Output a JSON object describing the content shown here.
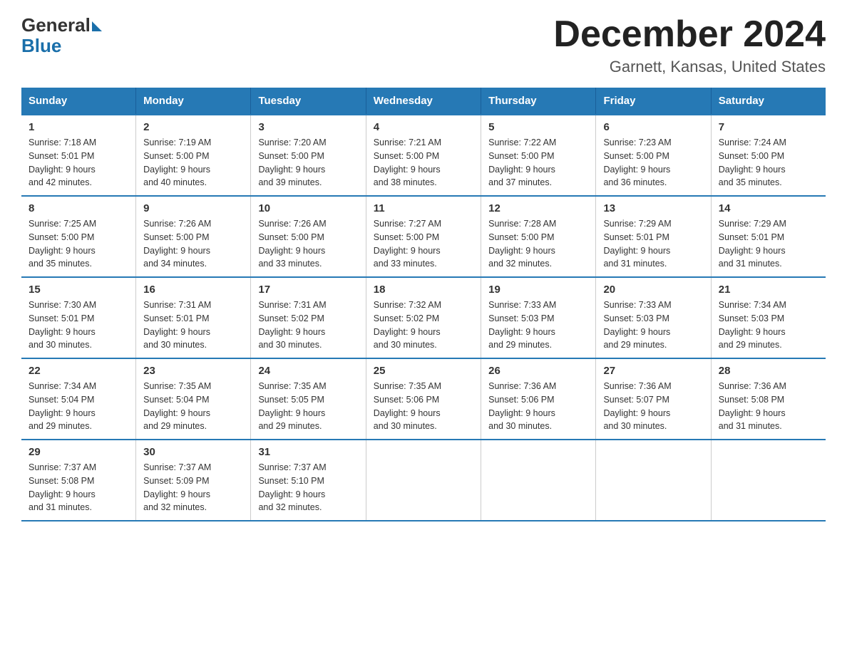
{
  "logo": {
    "general": "General",
    "blue": "Blue"
  },
  "title": "December 2024",
  "subtitle": "Garnett, Kansas, United States",
  "days_of_week": [
    "Sunday",
    "Monday",
    "Tuesday",
    "Wednesday",
    "Thursday",
    "Friday",
    "Saturday"
  ],
  "weeks": [
    [
      {
        "day": "1",
        "sunrise": "7:18 AM",
        "sunset": "5:01 PM",
        "daylight": "9 hours and 42 minutes."
      },
      {
        "day": "2",
        "sunrise": "7:19 AM",
        "sunset": "5:00 PM",
        "daylight": "9 hours and 40 minutes."
      },
      {
        "day": "3",
        "sunrise": "7:20 AM",
        "sunset": "5:00 PM",
        "daylight": "9 hours and 39 minutes."
      },
      {
        "day": "4",
        "sunrise": "7:21 AM",
        "sunset": "5:00 PM",
        "daylight": "9 hours and 38 minutes."
      },
      {
        "day": "5",
        "sunrise": "7:22 AM",
        "sunset": "5:00 PM",
        "daylight": "9 hours and 37 minutes."
      },
      {
        "day": "6",
        "sunrise": "7:23 AM",
        "sunset": "5:00 PM",
        "daylight": "9 hours and 36 minutes."
      },
      {
        "day": "7",
        "sunrise": "7:24 AM",
        "sunset": "5:00 PM",
        "daylight": "9 hours and 35 minutes."
      }
    ],
    [
      {
        "day": "8",
        "sunrise": "7:25 AM",
        "sunset": "5:00 PM",
        "daylight": "9 hours and 35 minutes."
      },
      {
        "day": "9",
        "sunrise": "7:26 AM",
        "sunset": "5:00 PM",
        "daylight": "9 hours and 34 minutes."
      },
      {
        "day": "10",
        "sunrise": "7:26 AM",
        "sunset": "5:00 PM",
        "daylight": "9 hours and 33 minutes."
      },
      {
        "day": "11",
        "sunrise": "7:27 AM",
        "sunset": "5:00 PM",
        "daylight": "9 hours and 33 minutes."
      },
      {
        "day": "12",
        "sunrise": "7:28 AM",
        "sunset": "5:00 PM",
        "daylight": "9 hours and 32 minutes."
      },
      {
        "day": "13",
        "sunrise": "7:29 AM",
        "sunset": "5:01 PM",
        "daylight": "9 hours and 31 minutes."
      },
      {
        "day": "14",
        "sunrise": "7:29 AM",
        "sunset": "5:01 PM",
        "daylight": "9 hours and 31 minutes."
      }
    ],
    [
      {
        "day": "15",
        "sunrise": "7:30 AM",
        "sunset": "5:01 PM",
        "daylight": "9 hours and 30 minutes."
      },
      {
        "day": "16",
        "sunrise": "7:31 AM",
        "sunset": "5:01 PM",
        "daylight": "9 hours and 30 minutes."
      },
      {
        "day": "17",
        "sunrise": "7:31 AM",
        "sunset": "5:02 PM",
        "daylight": "9 hours and 30 minutes."
      },
      {
        "day": "18",
        "sunrise": "7:32 AM",
        "sunset": "5:02 PM",
        "daylight": "9 hours and 30 minutes."
      },
      {
        "day": "19",
        "sunrise": "7:33 AM",
        "sunset": "5:03 PM",
        "daylight": "9 hours and 29 minutes."
      },
      {
        "day": "20",
        "sunrise": "7:33 AM",
        "sunset": "5:03 PM",
        "daylight": "9 hours and 29 minutes."
      },
      {
        "day": "21",
        "sunrise": "7:34 AM",
        "sunset": "5:03 PM",
        "daylight": "9 hours and 29 minutes."
      }
    ],
    [
      {
        "day": "22",
        "sunrise": "7:34 AM",
        "sunset": "5:04 PM",
        "daylight": "9 hours and 29 minutes."
      },
      {
        "day": "23",
        "sunrise": "7:35 AM",
        "sunset": "5:04 PM",
        "daylight": "9 hours and 29 minutes."
      },
      {
        "day": "24",
        "sunrise": "7:35 AM",
        "sunset": "5:05 PM",
        "daylight": "9 hours and 29 minutes."
      },
      {
        "day": "25",
        "sunrise": "7:35 AM",
        "sunset": "5:06 PM",
        "daylight": "9 hours and 30 minutes."
      },
      {
        "day": "26",
        "sunrise": "7:36 AM",
        "sunset": "5:06 PM",
        "daylight": "9 hours and 30 minutes."
      },
      {
        "day": "27",
        "sunrise": "7:36 AM",
        "sunset": "5:07 PM",
        "daylight": "9 hours and 30 minutes."
      },
      {
        "day": "28",
        "sunrise": "7:36 AM",
        "sunset": "5:08 PM",
        "daylight": "9 hours and 31 minutes."
      }
    ],
    [
      {
        "day": "29",
        "sunrise": "7:37 AM",
        "sunset": "5:08 PM",
        "daylight": "9 hours and 31 minutes."
      },
      {
        "day": "30",
        "sunrise": "7:37 AM",
        "sunset": "5:09 PM",
        "daylight": "9 hours and 32 minutes."
      },
      {
        "day": "31",
        "sunrise": "7:37 AM",
        "sunset": "5:10 PM",
        "daylight": "9 hours and 32 minutes."
      },
      null,
      null,
      null,
      null
    ]
  ],
  "labels": {
    "sunrise": "Sunrise:",
    "sunset": "Sunset:",
    "daylight": "Daylight:"
  }
}
